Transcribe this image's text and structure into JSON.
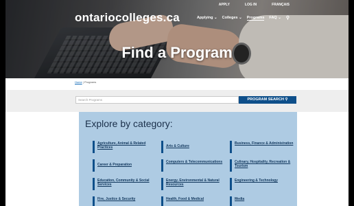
{
  "site": {
    "logo": "ontariocolleges.ca"
  },
  "utility_nav": [
    "APPLY",
    "LOG IN",
    "FRANÇAIS"
  ],
  "main_nav": [
    {
      "label": "Applying ⌄",
      "active": false
    },
    {
      "label": "Colleges ⌄",
      "active": false
    },
    {
      "label": "Programs",
      "active": true
    },
    {
      "label": "FAQ ⌄",
      "active": false
    }
  ],
  "hero": {
    "title": "Find a Program"
  },
  "breadcrumb": {
    "home": "Home",
    "separator": "|",
    "current": "Programs"
  },
  "search": {
    "placeholder": "Search Programs",
    "button": "PROGRAM SEARCH",
    "button_icon": "search-icon"
  },
  "categories_panel": {
    "title": "Explore by category:",
    "items": [
      {
        "label": "Agriculture, Animal & Related Practices"
      },
      {
        "label": "Arts & Culture"
      },
      {
        "label": "Business, Finance & Administration"
      },
      {
        "label": "Career & Preparation"
      },
      {
        "label": "Computers & Telecommunications"
      },
      {
        "label": "Culinary, Hospitality, Recreation & Tourism"
      },
      {
        "label": "Education, Community & Social Services"
      },
      {
        "label": "Energy, Environmental & Natural Resources"
      },
      {
        "label": "Engineering & Technology"
      },
      {
        "label": "Fire, Justice & Security"
      },
      {
        "label": "Health, Food & Medical"
      },
      {
        "label": "Media"
      }
    ]
  },
  "colors": {
    "brand_blue": "#0e4f8a",
    "panel_bg": "#aecbe3",
    "search_band": "#eeeeee"
  }
}
